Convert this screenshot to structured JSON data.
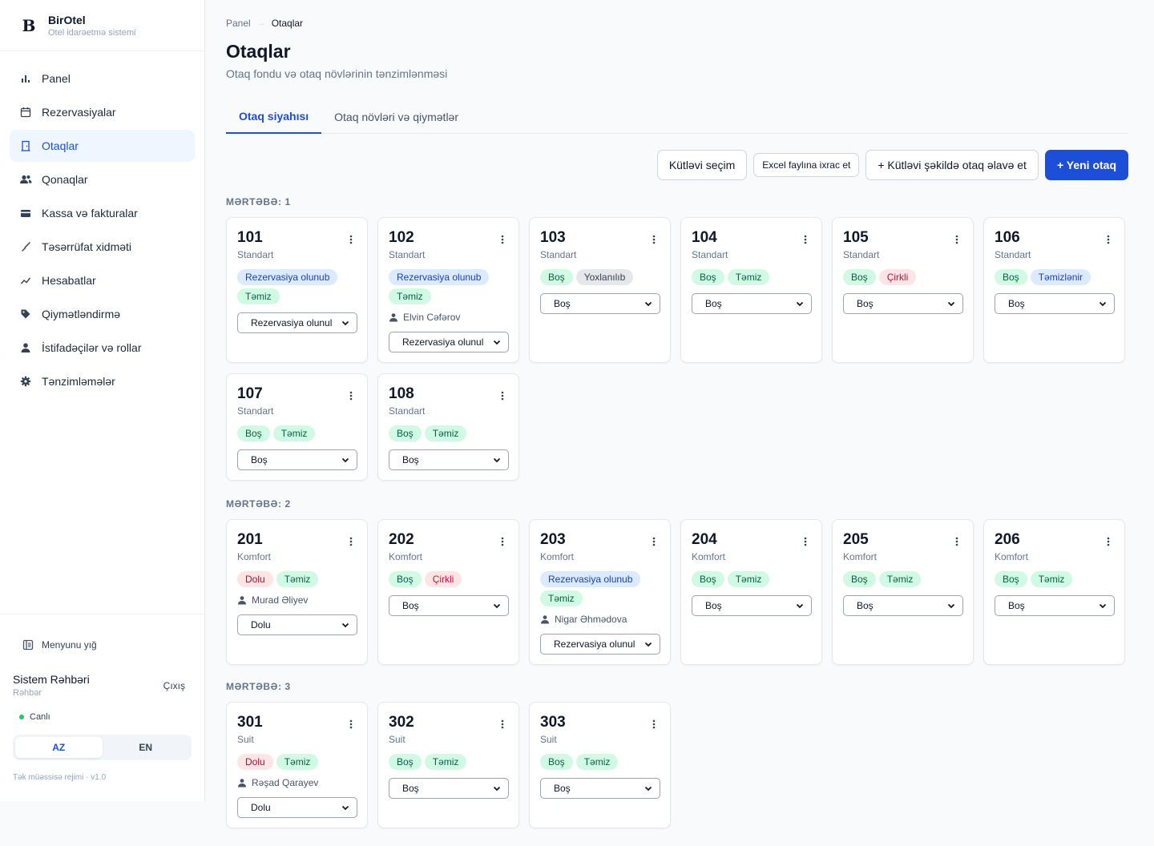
{
  "app": {
    "name": "BirOtel",
    "subtitle": "Otel idarəetmə sistemi",
    "logo": "B"
  },
  "sidebar": {
    "items": [
      {
        "label": "Panel",
        "icon": "bar-chart-icon",
        "active": false
      },
      {
        "label": "Rezervasiyalar",
        "icon": "calendar-icon",
        "active": false
      },
      {
        "label": "Otaqlar",
        "icon": "door-icon",
        "active": true
      },
      {
        "label": "Qonaqlar",
        "icon": "users-icon",
        "active": false
      },
      {
        "label": "Kassa və fakturalar",
        "icon": "wallet-icon",
        "active": false
      },
      {
        "label": "Təsərrüfat xidməti",
        "icon": "broom-icon",
        "active": false
      },
      {
        "label": "Hesabatlar",
        "icon": "trend-icon",
        "active": false
      },
      {
        "label": "Qiymətləndirmə",
        "icon": "tag-icon",
        "active": false
      },
      {
        "label": "İstifadəçilər və rollar",
        "icon": "user-icon",
        "active": false
      },
      {
        "label": "Tənzimləmələr",
        "icon": "gear-icon",
        "active": false
      }
    ],
    "collapse_label": "Menyunu yığ",
    "user": {
      "name": "Sistem Rəhbəri",
      "role": "Rəhbər",
      "logout": "Çıxış"
    },
    "status": "Canlı",
    "lang": {
      "az": "AZ",
      "en": "EN",
      "selected": "AZ"
    },
    "version": "Tək müəssisə rejimi · v1.0"
  },
  "breadcrumb": {
    "parent": "Panel",
    "current": "Otaqlar"
  },
  "page": {
    "title": "Otaqlar",
    "subtitle": "Otaq fondu və otaq növlərinin tənzimlənməsi"
  },
  "tabs": [
    {
      "label": "Otaq siyahısı",
      "active": true
    },
    {
      "label": "Otaq növləri və qiymətlər",
      "active": false
    }
  ],
  "actions": {
    "bulk_select": "Kütləvi seçim",
    "export_excel": "Excel faylına ixrac et",
    "bulk_add": "+ Kütləvi şəkildə otaq əlavə et",
    "new_room": "+ Yeni otaq"
  },
  "colors": {
    "accent": "#1d4ed8",
    "active_bg": "#eff6ff",
    "live": "#22c55e"
  },
  "floors": [
    {
      "label": "MƏRTƏBƏ: 1",
      "rooms": [
        {
          "number": "101",
          "type": "Standart",
          "badges": [
            {
              "text": "Rezervasiya olunub",
              "kind": "rezerv"
            },
            {
              "text": "Təmiz",
              "kind": "temiz"
            }
          ],
          "guest": "",
          "status": "Rezervasiya olunul"
        },
        {
          "number": "102",
          "type": "Standart",
          "badges": [
            {
              "text": "Rezervasiya olunub",
              "kind": "rezerv"
            },
            {
              "text": "Təmiz",
              "kind": "temiz"
            }
          ],
          "guest": "Elvin Cəfərov",
          "status": "Rezervasiya olunul"
        },
        {
          "number": "103",
          "type": "Standart",
          "badges": [
            {
              "text": "Boş",
              "kind": "bos"
            },
            {
              "text": "Yoxlanılıb",
              "kind": "yoxlan"
            }
          ],
          "guest": "",
          "status": "Boş"
        },
        {
          "number": "104",
          "type": "Standart",
          "badges": [
            {
              "text": "Boş",
              "kind": "bos"
            },
            {
              "text": "Təmiz",
              "kind": "temiz"
            }
          ],
          "guest": "",
          "status": "Boş"
        },
        {
          "number": "105",
          "type": "Standart",
          "badges": [
            {
              "text": "Boş",
              "kind": "bos"
            },
            {
              "text": "Çirkli",
              "kind": "cirkli"
            }
          ],
          "guest": "",
          "status": "Boş"
        },
        {
          "number": "106",
          "type": "Standart",
          "badges": [
            {
              "text": "Boş",
              "kind": "bos"
            },
            {
              "text": "Təmizlənir",
              "kind": "temizlenir"
            }
          ],
          "guest": "",
          "status": "Boş"
        },
        {
          "number": "107",
          "type": "Standart",
          "badges": [
            {
              "text": "Boş",
              "kind": "bos"
            },
            {
              "text": "Təmiz",
              "kind": "temiz"
            }
          ],
          "guest": "",
          "status": "Boş"
        },
        {
          "number": "108",
          "type": "Standart",
          "badges": [
            {
              "text": "Boş",
              "kind": "bos"
            },
            {
              "text": "Təmiz",
              "kind": "temiz"
            }
          ],
          "guest": "",
          "status": "Boş"
        }
      ]
    },
    {
      "label": "MƏRTƏBƏ: 2",
      "rooms": [
        {
          "number": "201",
          "type": "Komfort",
          "badges": [
            {
              "text": "Dolu",
              "kind": "dolu"
            },
            {
              "text": "Təmiz",
              "kind": "temiz"
            }
          ],
          "guest": "Murad Əliyev",
          "status": "Dolu"
        },
        {
          "number": "202",
          "type": "Komfort",
          "badges": [
            {
              "text": "Boş",
              "kind": "bos"
            },
            {
              "text": "Çirkli",
              "kind": "cirkli"
            }
          ],
          "guest": "",
          "status": "Boş"
        },
        {
          "number": "203",
          "type": "Komfort",
          "badges": [
            {
              "text": "Rezervasiya olunub",
              "kind": "rezerv"
            },
            {
              "text": "Təmiz",
              "kind": "temiz"
            }
          ],
          "guest": "Nigar Əhmədova",
          "status": "Rezervasiya olunul"
        },
        {
          "number": "204",
          "type": "Komfort",
          "badges": [
            {
              "text": "Boş",
              "kind": "bos"
            },
            {
              "text": "Təmiz",
              "kind": "temiz"
            }
          ],
          "guest": "",
          "status": "Boş"
        },
        {
          "number": "205",
          "type": "Komfort",
          "badges": [
            {
              "text": "Boş",
              "kind": "bos"
            },
            {
              "text": "Təmiz",
              "kind": "temiz"
            }
          ],
          "guest": "",
          "status": "Boş"
        },
        {
          "number": "206",
          "type": "Komfort",
          "badges": [
            {
              "text": "Boş",
              "kind": "bos"
            },
            {
              "text": "Təmiz",
              "kind": "temiz"
            }
          ],
          "guest": "",
          "status": "Boş"
        }
      ]
    },
    {
      "label": "MƏRTƏBƏ: 3",
      "rooms": [
        {
          "number": "301",
          "type": "Suit",
          "badges": [
            {
              "text": "Dolu",
              "kind": "dolu"
            },
            {
              "text": "Təmiz",
              "kind": "temiz"
            }
          ],
          "guest": "Rəşad Qarayev",
          "status": "Dolu"
        },
        {
          "number": "302",
          "type": "Suit",
          "badges": [
            {
              "text": "Boş",
              "kind": "bos"
            },
            {
              "text": "Təmiz",
              "kind": "temiz"
            }
          ],
          "guest": "",
          "status": "Boş"
        },
        {
          "number": "303",
          "type": "Suit",
          "badges": [
            {
              "text": "Boş",
              "kind": "bos"
            },
            {
              "text": "Təmiz",
              "kind": "temiz"
            }
          ],
          "guest": "",
          "status": "Boş"
        }
      ]
    }
  ]
}
